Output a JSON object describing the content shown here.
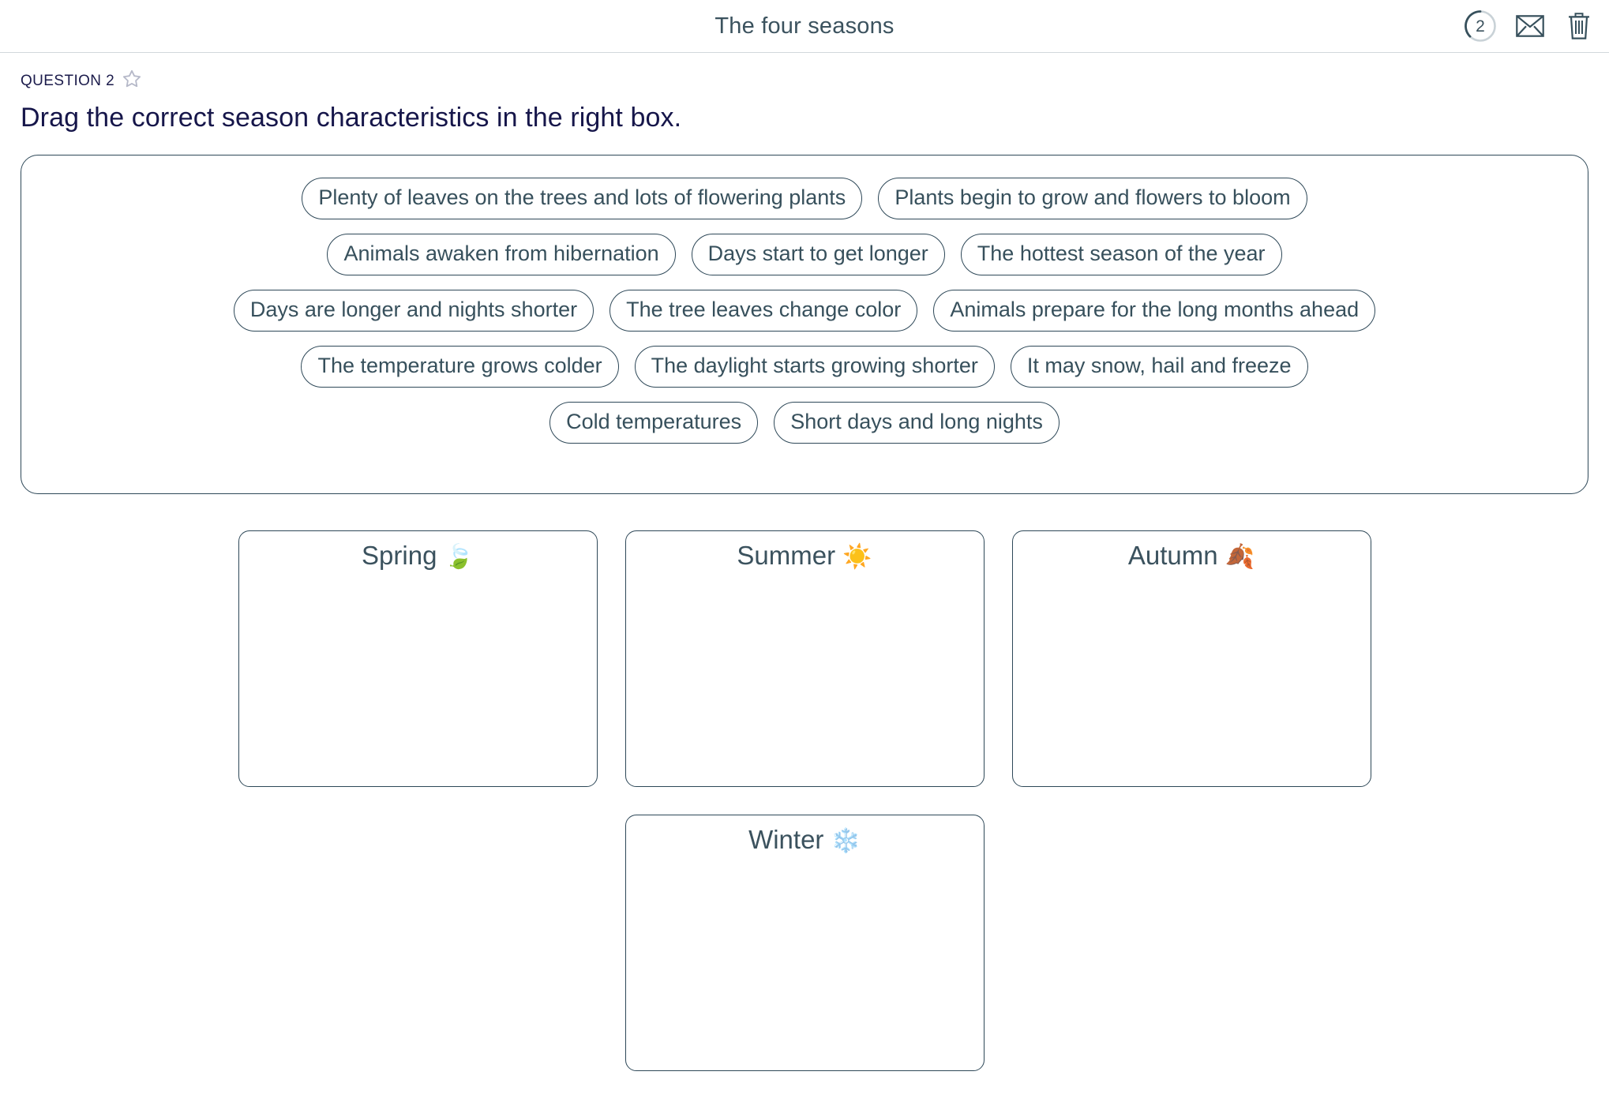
{
  "header": {
    "title": "The four seasons",
    "progress_count": "2",
    "mail_icon": "envelope-icon",
    "trash_icon": "trash-icon",
    "progress_icon": "progress-ring-icon"
  },
  "question": {
    "label": "QUESTION 2",
    "star_icon": "star-outline-icon",
    "prompt": "Drag the correct season characteristics in the right box."
  },
  "pool": {
    "rows": [
      [
        "Plenty of leaves on the trees and lots of flowering plants",
        "Plants begin to grow and flowers to bloom"
      ],
      [
        "Animals awaken from hibernation",
        "Days start to get longer",
        "The hottest season of the year"
      ],
      [
        "Days are longer and nights shorter",
        "The tree leaves change color",
        "Animals prepare for the long months ahead"
      ],
      [
        "The temperature grows colder",
        "The daylight starts growing shorter",
        "It may snow, hail and freeze"
      ],
      [
        "Cold temperatures",
        "Short days and long nights"
      ]
    ]
  },
  "dropzones": {
    "top": [
      {
        "label": "Spring",
        "emoji": "🍃",
        "emoji_name": "leaf-fluttering-in-wind-emoji",
        "items": []
      },
      {
        "label": "Summer",
        "emoji": "☀️",
        "emoji_name": "sun-emoji",
        "items": []
      },
      {
        "label": "Autumn",
        "emoji": "🍂",
        "emoji_name": "fallen-leaf-emoji",
        "items": []
      }
    ],
    "bottom": [
      {
        "label": "Winter",
        "emoji": "❄️",
        "emoji_name": "snowflake-emoji",
        "items": []
      }
    ]
  },
  "colors": {
    "border": "#2e4858",
    "text": "#37505c",
    "prompt_text": "#16164a",
    "star": "#b6b9c9",
    "divider": "#d2d8dc"
  }
}
